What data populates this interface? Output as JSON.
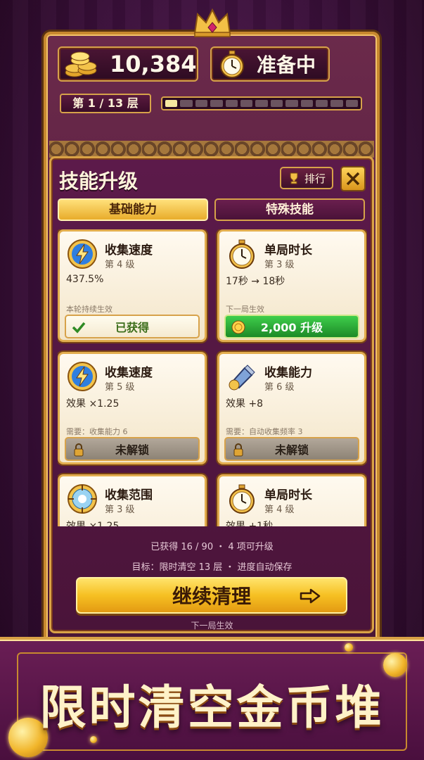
{
  "hud": {
    "coins": "10,384",
    "status": "准备中",
    "level": "第 1 / 13 层",
    "progress_segments": 13,
    "progress_filled": 1
  },
  "panel": {
    "title": "技能升级",
    "rank_label": "排行",
    "tabs": [
      "基础能力",
      "特殊技能"
    ],
    "active_tab": 0
  },
  "skills": [
    {
      "name": "收集速度",
      "level": "第 4 级",
      "effect": "437.5%",
      "note": "本轮持续生效",
      "action": "已获得",
      "state": "owned",
      "icon": "lightning-icon"
    },
    {
      "name": "单局时长",
      "level": "第 3 级",
      "effect": "17秒 → 18秒",
      "note": "下一局生效",
      "action": "2,000 升级",
      "state": "upgrade",
      "icon": "stopwatch-icon"
    },
    {
      "name": "收集速度",
      "level": "第 5 级",
      "effect": "效果 ×1.25",
      "note": "需要：收集能力 6",
      "action": "未解锁",
      "state": "locked",
      "icon": "lightning-icon"
    },
    {
      "name": "收集能力",
      "level": "第 6 级",
      "effect": "效果 +8",
      "note": "需要：自动收集频率 3",
      "action": "未解锁",
      "state": "locked",
      "icon": "magnet-icon"
    },
    {
      "name": "收集范围",
      "level": "第 3 级",
      "effect": "效果 ×1.25",
      "note": "",
      "action": "",
      "state": "partial",
      "icon": "target-icon"
    },
    {
      "name": "单局时长",
      "level": "第 4 级",
      "effect": "效果 +1秒",
      "note": "",
      "action": "",
      "state": "partial",
      "icon": "stopwatch-icon"
    }
  ],
  "footer": {
    "stat_line": "已获得 16 / 90 ・ 4 项可升级",
    "goal_line": "目标：限时清空 13 层 ・ 进度自动保存",
    "cta_label": "继续清理",
    "note": "下一局生效"
  },
  "banner": {
    "text": "限时清空金币堆"
  },
  "colors": {
    "gold": "#d9a246",
    "panel": "#4a1439",
    "green": "#1c8a27",
    "cream": "#fffaf0"
  }
}
